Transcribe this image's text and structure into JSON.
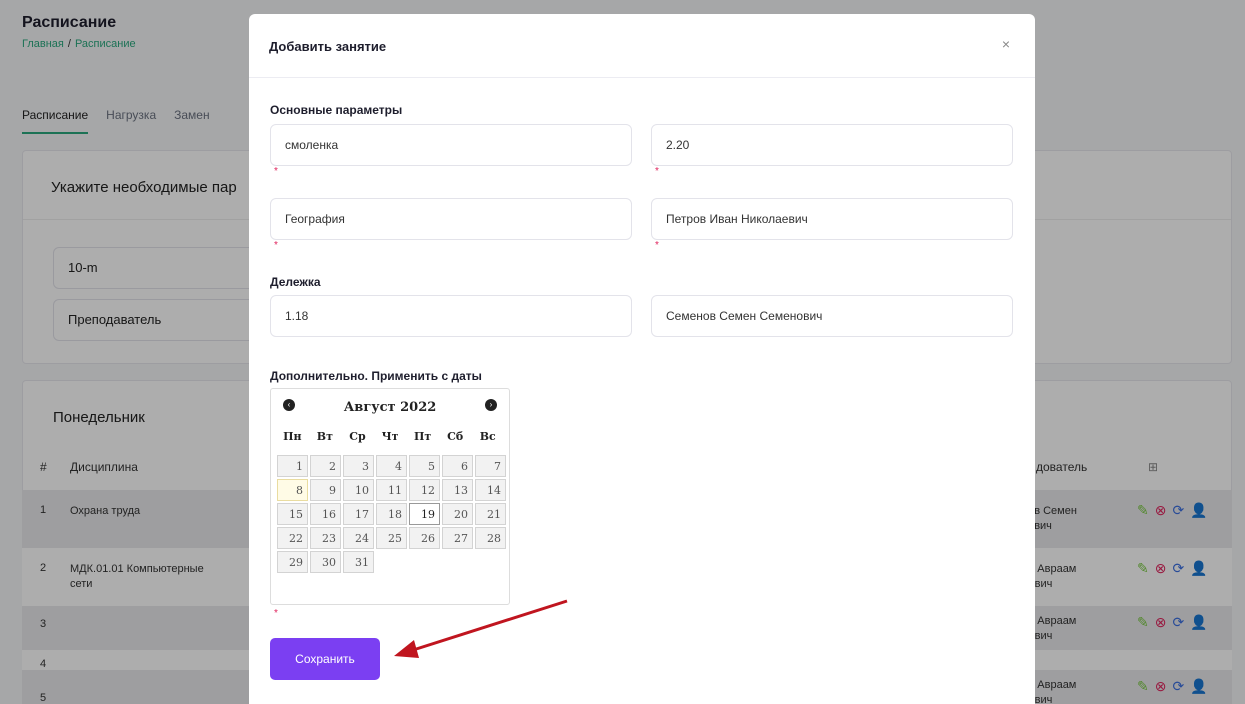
{
  "background": {
    "title": "Расписание",
    "breadcrumb": {
      "home": "Главная",
      "sep": "/",
      "current": "Расписание"
    },
    "tabs": [
      "Расписание",
      "Нагрузка",
      "Замен"
    ],
    "filter_header": "Укажите необходимые пар",
    "filter_group": "10-m",
    "filter_role": "Преподаватель",
    "day_title": "Понедельник",
    "columns": {
      "num": "#",
      "discipline": "Дисциплина",
      "teacher": "дователь"
    },
    "rows": [
      {
        "num": "1",
        "discipline": "Охрана труда",
        "teacher": "нов Семен\nнович"
      },
      {
        "num": "2",
        "discipline": "МДК.01.01 Компьютерные\nсети",
        "teacher": "ин Авраам\nлович"
      },
      {
        "num": "3",
        "discipline": "",
        "teacher": "ин Авраам\nлович"
      },
      {
        "num": "4",
        "discipline": "",
        "teacher": ""
      },
      {
        "num": "5",
        "discipline": "",
        "teacher": "ин Авраам\nлович"
      }
    ]
  },
  "modal": {
    "title": "Добавить занятие",
    "close": "×",
    "section_main": "Основные параметры",
    "fields": {
      "place": "смоленка",
      "room": "2.20",
      "subject": "География",
      "teacher": "Петров Иван Николаевич"
    },
    "section_split": "Дележка",
    "split_fields": {
      "room": "1.18",
      "teacher": "Семенов Семен Семенович"
    },
    "section_extra": "Дополнительно. Применить с даты",
    "required_mark": "*",
    "calendar": {
      "month": "Август 2022",
      "prev": "‹",
      "next": "›",
      "weekdays": [
        "Пн",
        "Вт",
        "Ср",
        "Чт",
        "Пт",
        "Сб",
        "Вс"
      ],
      "days": [
        "1",
        "2",
        "3",
        "4",
        "5",
        "6",
        "7",
        "8",
        "9",
        "10",
        "11",
        "12",
        "13",
        "14",
        "15",
        "16",
        "17",
        "18",
        "19",
        "20",
        "21",
        "22",
        "23",
        "24",
        "25",
        "26",
        "27",
        "28",
        "29",
        "30",
        "31"
      ],
      "highlighted_day": "8",
      "selected_day": "19"
    },
    "save_label": "Сохранить"
  },
  "colors": {
    "accent": "#7b3ff2",
    "annotation_arrow": "#c0151f",
    "required": "#e0245e",
    "breadcrumb": "#2aa87e"
  }
}
